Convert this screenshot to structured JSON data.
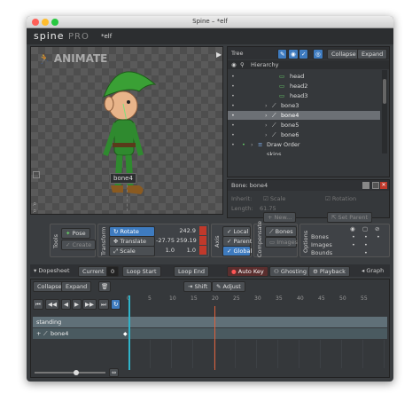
{
  "window": {
    "title": "Spine – *elf",
    "logo": "spine",
    "edition": "PRO",
    "project": "*elf"
  },
  "viewport": {
    "mode_label": "ANIMATE",
    "selected_bone_label": "bone4"
  },
  "tree": {
    "title": "Tree",
    "collapse_label": "Collapse",
    "expand_label": "Expand",
    "hierarchy_label": "Hierarchy",
    "items": [
      {
        "label": "head"
      },
      {
        "label": "head2"
      },
      {
        "label": "head3"
      },
      {
        "label": "bone3"
      },
      {
        "label": "bone4"
      },
      {
        "label": "bone5"
      },
      {
        "label": "bone6"
      },
      {
        "label": "Draw Order"
      },
      {
        "label": "skins"
      }
    ]
  },
  "bone_props": {
    "title": "Bone: bone4",
    "inherit_label": "Inherit:",
    "scale_label": "Scale",
    "rotation_label": "Rotation",
    "length_label": "Length:",
    "length_value": "61.75",
    "new_label": "New...",
    "set_parent_label": "Set Parent"
  },
  "tools": {
    "group_label": "Tools",
    "pose_label": "Pose",
    "create_label": "Create"
  },
  "transform": {
    "group_label": "Transform",
    "rotate_label": "Rotate",
    "rotate_value": "242.9",
    "translate_label": "Translate",
    "translate_x": "-27.75",
    "translate_y": "259.19",
    "scale_label": "Scale",
    "scale_x": "1.0",
    "scale_y": "1.0"
  },
  "axis": {
    "group_label": "Axis",
    "local_label": "Local",
    "parent_label": "Parent",
    "global_label": "Global"
  },
  "compensate": {
    "group_label": "Compensate",
    "bones_label": "Bones",
    "images_label": "Images"
  },
  "options": {
    "group_label": "Options",
    "rows": [
      "Bones",
      "Images",
      "Bounds"
    ]
  },
  "dopesheet": {
    "title": "Dopesheet",
    "current_label": "Current",
    "current_value": "0",
    "loop_start_label": "Loop Start",
    "loop_end_label": "Loop End",
    "auto_key_label": "Auto Key",
    "ghosting_label": "Ghosting",
    "playback_label": "Playback",
    "graph_label": "Graph",
    "collapse_label": "Collapse",
    "expand_label": "Expand",
    "shift_label": "Shift",
    "adjust_label": "Adjust",
    "frame_ticks": [
      "0",
      "5",
      "10",
      "15",
      "20",
      "25",
      "30",
      "35",
      "40",
      "45",
      "50",
      "55"
    ],
    "animation_row": "standing",
    "bone_row": "bone4"
  },
  "colors": {
    "accent": "#3e7bbf",
    "auto_key_red": "#c0392b",
    "timeline_cursor": "#2fb3c9",
    "loop_marker": "#e0603a"
  }
}
